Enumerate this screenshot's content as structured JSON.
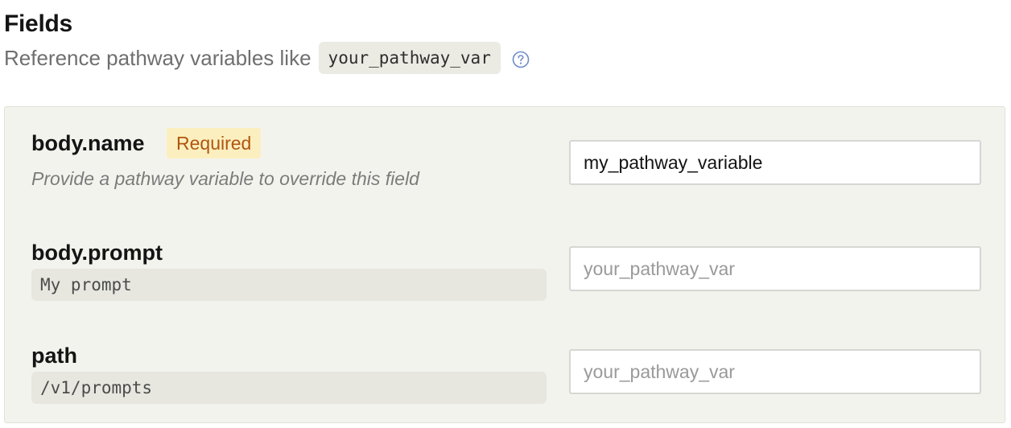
{
  "header": {
    "title": "Fields",
    "subtitle": "Reference pathway variables like",
    "example_variable": "your_pathway_var",
    "help_icon": "question-circle-icon"
  },
  "fields": [
    {
      "name": "body.name",
      "badge": "Required",
      "hint": "Provide a pathway variable to override this field",
      "input_value": "my_pathway_variable",
      "input_placeholder": "your_pathway_var"
    },
    {
      "name": "body.prompt",
      "default_value": "My prompt",
      "input_value": "",
      "input_placeholder": "your_pathway_var"
    },
    {
      "name": "path",
      "default_value": "/v1/prompts",
      "input_value": "",
      "input_placeholder": "your_pathway_var"
    }
  ],
  "colors": {
    "panel_background": "#f3f3ee",
    "badge_background": "#fcefbf",
    "badge_text": "#b0560f",
    "help_icon": "#6f8bc9"
  }
}
